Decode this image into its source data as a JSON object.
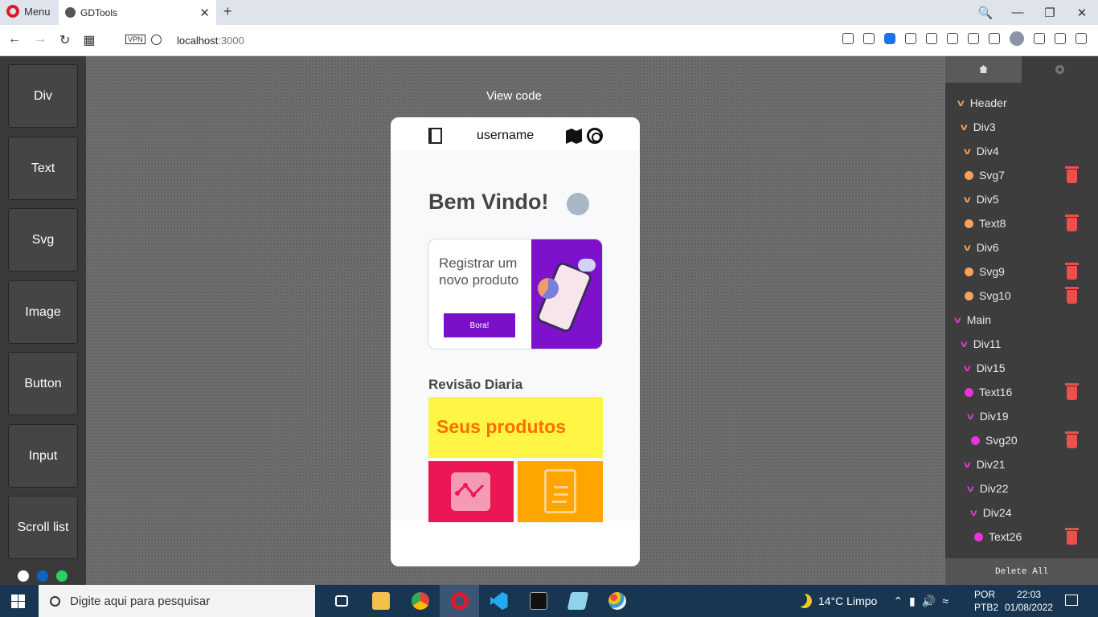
{
  "browser": {
    "menu_label": "Menu",
    "tab_title": "GDTools",
    "tab_close": "✕",
    "new_tab": "+",
    "vpn_badge": "VPN",
    "url_host": "localhost",
    "url_port": ":3000",
    "window_controls": [
      "🔍",
      "—",
      "❐",
      "✕"
    ]
  },
  "palette": {
    "items": [
      "Div",
      "Text",
      "Svg",
      "Image",
      "Button",
      "Input",
      "Scroll list"
    ]
  },
  "canvas": {
    "view_code_label": "View code",
    "phone": {
      "username": "username",
      "welcome": "Bem Vindo!",
      "register_text": "Registrar um novo produto",
      "register_button": "Bora!",
      "review_title": "Revisão Diaria",
      "products_text": "Seus produtos"
    }
  },
  "tree": {
    "rows": [
      {
        "label": "Header",
        "kind": "chev",
        "color": "#f5a25d",
        "trash": false
      },
      {
        "label": "Div3",
        "kind": "chev",
        "color": "#f5a25d",
        "trash": false
      },
      {
        "label": "Div4",
        "kind": "chev",
        "color": "#f5a25d",
        "trash": false
      },
      {
        "label": "Svg7",
        "kind": "dot",
        "color": "#f5a25d",
        "trash": true
      },
      {
        "label": "Div5",
        "kind": "chev",
        "color": "#f5a25d",
        "trash": false
      },
      {
        "label": "Text8",
        "kind": "dot",
        "color": "#f5a25d",
        "trash": true
      },
      {
        "label": "Div6",
        "kind": "chev",
        "color": "#f5a25d",
        "trash": false
      },
      {
        "label": "Svg9",
        "kind": "dot",
        "color": "#f5a25d",
        "trash": true
      },
      {
        "label": "Svg10",
        "kind": "dot",
        "color": "#f5a25d",
        "trash": true
      },
      {
        "label": "Main",
        "kind": "chev",
        "color": "#e934d8",
        "trash": false
      },
      {
        "label": "Div11",
        "kind": "chev",
        "color": "#e934d8",
        "trash": false
      },
      {
        "label": "Div15",
        "kind": "chev",
        "color": "#e934d8",
        "trash": false
      },
      {
        "label": "Text16",
        "kind": "dot",
        "color": "#e934d8",
        "trash": true
      },
      {
        "label": "Div19",
        "kind": "chev",
        "color": "#e934d8",
        "trash": false
      },
      {
        "label": "Svg20",
        "kind": "dot",
        "color": "#e934d8",
        "trash": true
      },
      {
        "label": "Div21",
        "kind": "chev",
        "color": "#e934d8",
        "trash": false
      },
      {
        "label": "Div22",
        "kind": "chev",
        "color": "#e934d8",
        "trash": false
      },
      {
        "label": "Div24",
        "kind": "chev",
        "color": "#e934d8",
        "trash": false
      },
      {
        "label": "Text26",
        "kind": "dot",
        "color": "#e934d8",
        "trash": true
      }
    ],
    "delete_all_label": "Delete All"
  },
  "taskbar": {
    "search_placeholder": "Digite aqui para pesquisar",
    "weather": "14°C  Limpo",
    "lang_1": "POR",
    "lang_2": "PTB2",
    "time": "22:03",
    "date": "01/08/2022"
  },
  "colors": {
    "accent_purple": "#7b0ec9",
    "products_yellow": "#fff544",
    "products_text_orange": "#ff6d00",
    "tile_red": "#ec1655",
    "tile_orange": "#ffa500",
    "trash_red": "#f04d4d"
  }
}
